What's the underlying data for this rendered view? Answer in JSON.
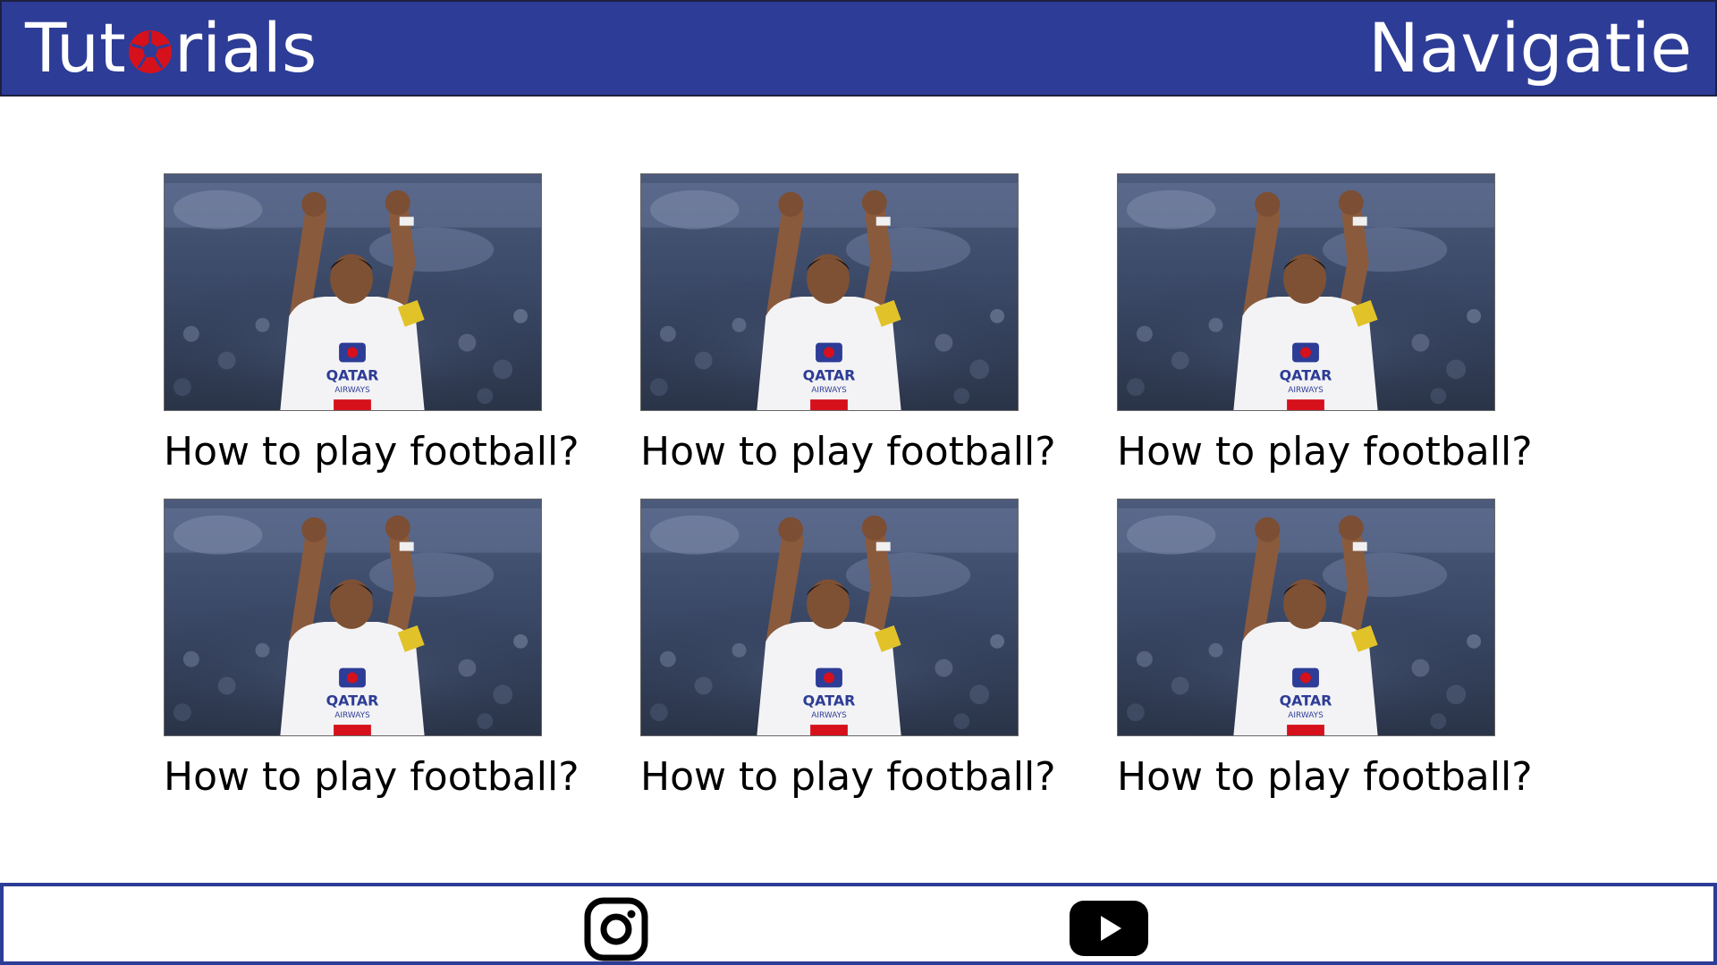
{
  "header": {
    "brand_prefix": "Tut",
    "brand_suffix": "rials",
    "brand_ball_icon": "football-icon",
    "nav_label": "Navigatie"
  },
  "tutorials": [
    {
      "title": "How to play football?"
    },
    {
      "title": "How to play football?"
    },
    {
      "title": "How to play football?"
    },
    {
      "title": "How to play football?"
    },
    {
      "title": "How to play football?"
    },
    {
      "title": "How to play football?"
    }
  ],
  "footer": {
    "icons": [
      "instagram-icon",
      "youtube-icon"
    ]
  },
  "colors": {
    "header_bg": "#2d3c96",
    "brand_ball": "#d6111b",
    "footer_border": "#2d3c96"
  }
}
